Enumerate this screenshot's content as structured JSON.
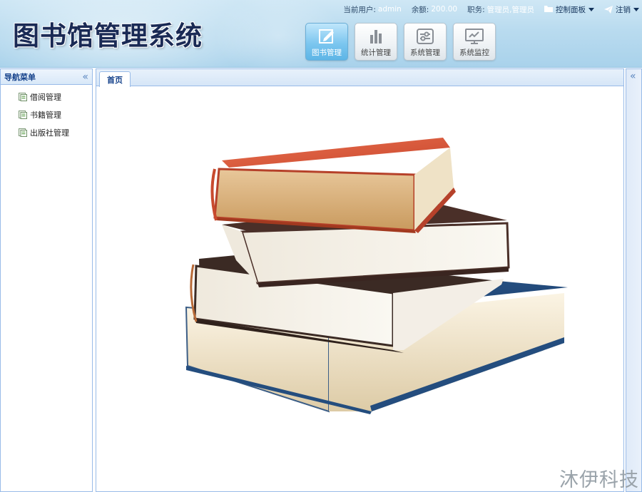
{
  "header": {
    "logo_text": "图书馆管理系统",
    "user_label": "当前用户:",
    "user_value": "admin",
    "balance_label": "余额:",
    "balance_value": "200.00",
    "role_label": "职务:",
    "role_value": "管理员,管理员",
    "control_panel": "控制面板",
    "logout": "注销"
  },
  "modules": [
    {
      "label": "图书管理",
      "icon": "edit-icon",
      "active": true
    },
    {
      "label": "统计管理",
      "icon": "bar-chart-icon",
      "active": false
    },
    {
      "label": "系统管理",
      "icon": "sliders-icon",
      "active": false
    },
    {
      "label": "系统监控",
      "icon": "monitor-icon",
      "active": false
    }
  ],
  "nav": {
    "title": "导航菜单",
    "collapse_glyph": "«",
    "items": [
      {
        "label": "借阅管理",
        "icon": "page-icon"
      },
      {
        "label": "书籍管理",
        "icon": "page-icon"
      },
      {
        "label": "出版社管理",
        "icon": "page-icon"
      }
    ]
  },
  "tabs": [
    {
      "label": "首页",
      "active": true
    }
  ],
  "right_panel": {
    "collapse_glyph": "«"
  },
  "main": {
    "image": "stack-of-books-illustration"
  },
  "watermark": "沐伊科技",
  "colors": {
    "header_bg": "#b9dbef",
    "active_module": "#7cc6ef",
    "panel_border": "#99bbe8",
    "panel_title": "#15428b"
  }
}
